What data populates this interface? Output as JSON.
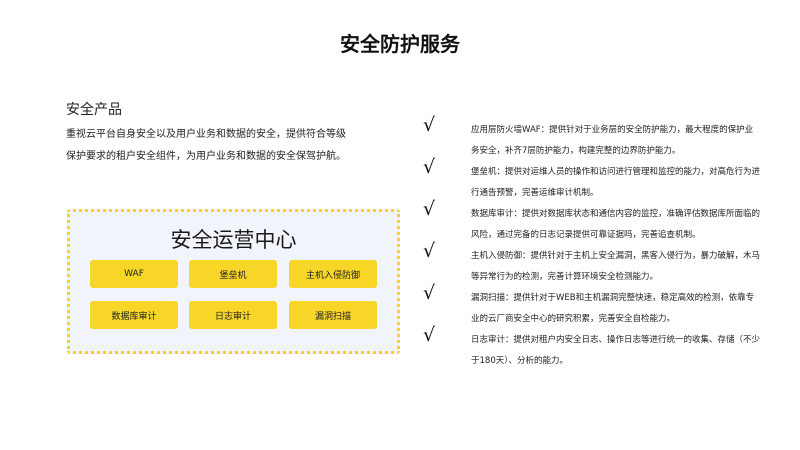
{
  "title": "安全防护服务",
  "product": {
    "heading": "安全产品",
    "description": "重视云平台自身安全以及用户业务和数据的安全，提供符合等级保护要求的租户安全组件，为用户业务和数据的安全保驾护航。"
  },
  "soc": {
    "title": "安全运营中心",
    "items": [
      "WAF",
      "堡垒机",
      "主机入侵防御",
      "数据库审计",
      "日志审计",
      "漏洞扫描"
    ]
  },
  "features": [
    "应用层防火墙WAF：提供针对于业务层的安全防护能力，最大程度的保护业务安全，补齐7层防护能力，构建完整的边界防护能力。",
    "堡垒机：提供对运维人员的操作和访问进行管理和监控的能力，对高危行为进行通告预警，完善运维审计机制。",
    "数据库审计：提供对数据库状态和通信内容的监控，准确评估数据库所面临的风险，通过完备的日志记录提供可靠证据吗，完善追查机制。",
    "主机入侵防御：提供针对于主机上安全漏洞，黑客入侵行为，暴力破解，木马等异常行为的检测，完善计算环境安全检测能力。",
    "漏洞扫描：提供针对于WEB和主机漏洞完整快速，稳定高效的检测，依靠专业的云厂商安全中心的研究积累，完善安全自检能力。",
    "日志审计：提供对租户内安全日志、操作日志等进行统一的收集、存储（不少于180天）、分析的能力。"
  ],
  "check_glyph": "√"
}
